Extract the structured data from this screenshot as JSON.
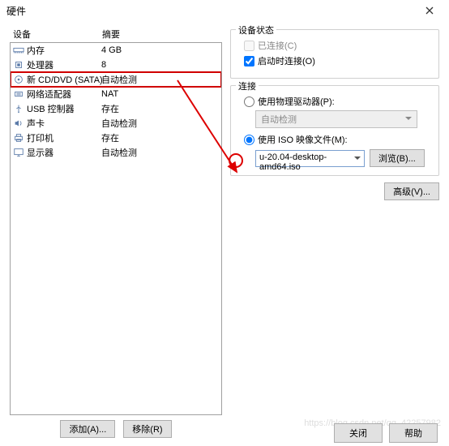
{
  "window": {
    "title": "硬件"
  },
  "headers": {
    "device": "设备",
    "summary": "摘要"
  },
  "devices": [
    {
      "key": "memory",
      "name": "内存",
      "summary": "4 GB",
      "icon": "memory"
    },
    {
      "key": "cpu",
      "name": "处理器",
      "summary": "8",
      "icon": "cpu"
    },
    {
      "key": "cddvd",
      "name": "新 CD/DVD (SATA)",
      "summary": "自动检测",
      "icon": "disc",
      "selected": true
    },
    {
      "key": "net",
      "name": "网络适配器",
      "summary": "NAT",
      "icon": "net"
    },
    {
      "key": "usb",
      "name": "USB 控制器",
      "summary": "存在",
      "icon": "usb"
    },
    {
      "key": "sound",
      "name": "声卡",
      "summary": "自动检测",
      "icon": "sound"
    },
    {
      "key": "printer",
      "name": "打印机",
      "summary": "存在",
      "icon": "printer"
    },
    {
      "key": "display",
      "name": "显示器",
      "summary": "自动检测",
      "icon": "display"
    }
  ],
  "left_buttons": {
    "add": "添加(A)...",
    "remove": "移除(R)"
  },
  "status": {
    "title": "设备状态",
    "connected": "已连接(C)",
    "connect_on": "启动时连接(O)"
  },
  "connection": {
    "title": "连接",
    "physical": "使用物理驱动器(P):",
    "auto_detect": "自动检测",
    "use_iso": "使用 ISO 映像文件(M):",
    "iso_value": "u-20.04-desktop-amd64.iso",
    "browse": "浏览(B)..."
  },
  "advanced": "高级(V)...",
  "footer": {
    "close": "关闭",
    "help": "帮助"
  },
  "watermark": "https://blog.csdn.net/qq_42257982"
}
